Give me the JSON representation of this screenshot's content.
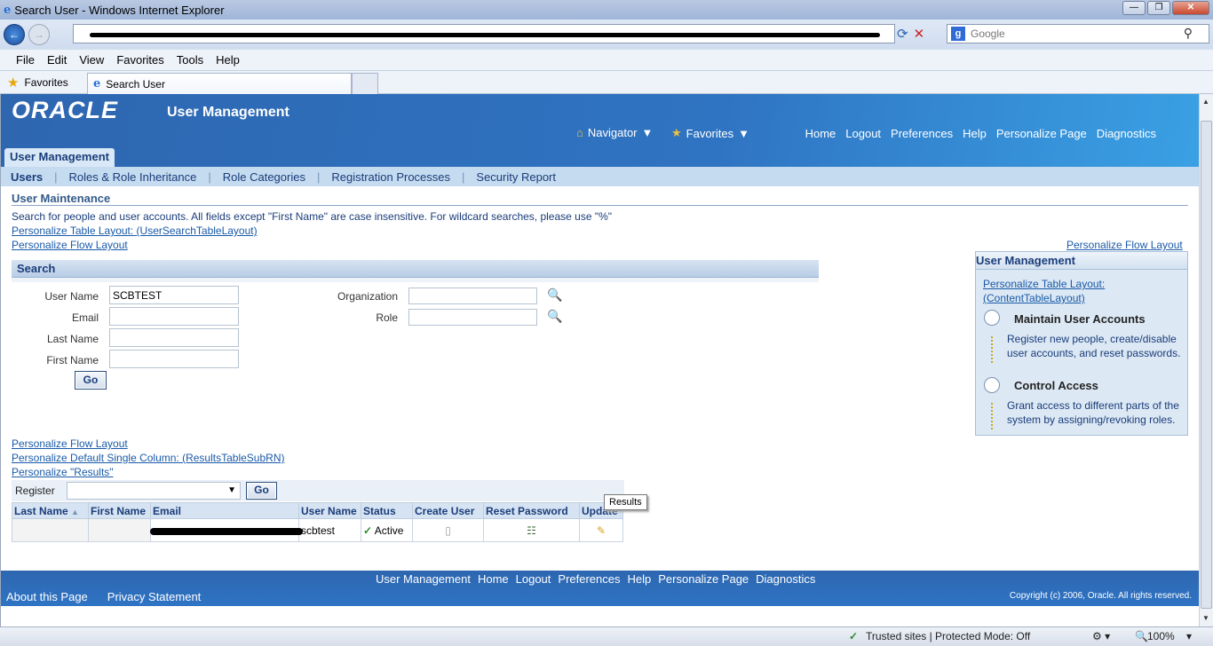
{
  "window": {
    "title": "Search User - Windows Internet Explorer"
  },
  "browser": {
    "search_placeholder": "Google",
    "menu": [
      "File",
      "Edit",
      "View",
      "Favorites",
      "Tools",
      "Help"
    ],
    "favorites_label": "Favorites",
    "tab_label": "Search User"
  },
  "header": {
    "logo": "ORACLE",
    "app_title": "User Management",
    "navigator": "Navigator",
    "favorites": "Favorites",
    "links": [
      "Home",
      "Logout",
      "Preferences",
      "Help",
      "Personalize Page",
      "Diagnostics"
    ],
    "app_tab": "User Management"
  },
  "subnav": [
    "Users",
    "Roles & Role Inheritance",
    "Role Categories",
    "Registration Processes",
    "Security Report"
  ],
  "main": {
    "section_title": "User Maintenance",
    "instructions": "Search for people and user accounts. All fields except \"First Name\" are case insensitive. For wildcard searches, please use \"%\"",
    "link_table_layout": "Personalize Table Layout: (UserSearchTableLayout)",
    "link_flow_layout": "Personalize Flow Layout",
    "link_flow_layout_right": "Personalize Flow Layout"
  },
  "search": {
    "title": "Search",
    "user_name_label": "User Name",
    "user_name_value": "SCBTEST",
    "email_label": "Email",
    "last_name_label": "Last Name",
    "first_name_label": "First Name",
    "organization_label": "Organization",
    "role_label": "Role",
    "go": "Go"
  },
  "sidebox": {
    "title": "User Management",
    "link": "Personalize Table Layout: (ContentTableLayout)",
    "maintain_title": "Maintain User Accounts",
    "maintain_desc": "Register new people, create/disable user accounts, and reset passwords.",
    "control_title": "Control Access",
    "control_desc": "Grant access to different parts of the system by assigning/revoking roles."
  },
  "results": {
    "link_flow": "Personalize Flow Layout",
    "link_default": "Personalize Default Single Column: (ResultsTableSubRN)",
    "link_results": "Personalize \"Results\"",
    "register_label": "Register",
    "go": "Go",
    "columns": [
      "Last Name",
      "First Name",
      "Email",
      "User Name",
      "Status",
      "Create User",
      "Reset Password",
      "Update"
    ],
    "row": {
      "user_name": "scbtest",
      "status": "Active"
    },
    "tooltip": "Results"
  },
  "footer": {
    "links": [
      "User Management",
      "Home",
      "Logout",
      "Preferences",
      "Help",
      "Personalize Page",
      "Diagnostics"
    ],
    "about": "About this Page",
    "privacy": "Privacy Statement",
    "copyright": "Copyright (c) 2006, Oracle. All rights reserved."
  },
  "status": {
    "zone": "Trusted sites | Protected Mode: Off",
    "zoom": "100%"
  }
}
